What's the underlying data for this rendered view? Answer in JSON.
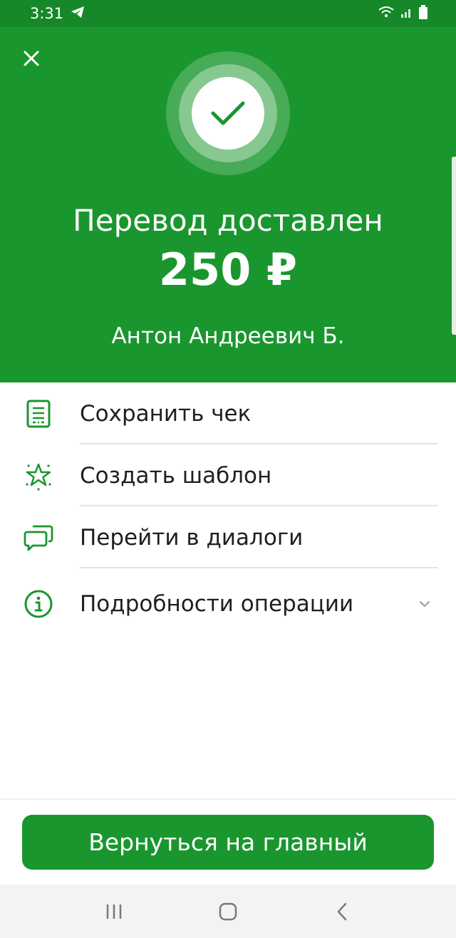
{
  "status_bar": {
    "time": "3:31",
    "icons": [
      "telegram-icon",
      "wifi-icon",
      "signal-icon",
      "battery-icon"
    ]
  },
  "colors": {
    "primary_green": "#1a962e",
    "status_green": "#16882a",
    "icon_green": "#1a962e"
  },
  "hero": {
    "title": "Перевод доставлен",
    "amount": "250 ₽",
    "recipient": "Антон Андреевич Б."
  },
  "actions": [
    {
      "icon": "receipt-icon",
      "label": "Сохранить чек"
    },
    {
      "icon": "star-icon",
      "label": "Создать шаблон"
    },
    {
      "icon": "chat-icon",
      "label": "Перейти в диалоги"
    },
    {
      "icon": "info-icon",
      "label": "Подробности операции"
    }
  ],
  "footer": {
    "button_label": "Вернуться на главный"
  },
  "nav_bar": {
    "buttons": [
      "recent-apps-icon",
      "home-icon",
      "back-icon"
    ]
  }
}
